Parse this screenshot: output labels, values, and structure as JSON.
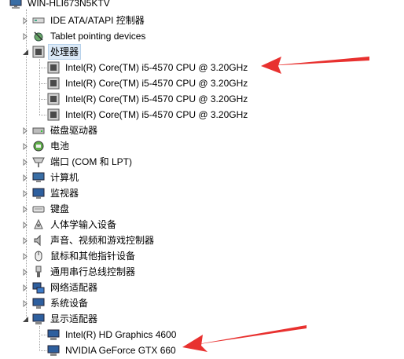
{
  "computer": {
    "name": "WIN-HLI673N5KTV"
  },
  "tree": [
    {
      "id": "ide",
      "label": "IDE ATA/ATAPI 控制器",
      "icon": "ide-controller-icon",
      "expanded": false
    },
    {
      "id": "tablet",
      "label": "Tablet pointing devices",
      "icon": "tablet-icon",
      "expanded": false
    },
    {
      "id": "processors",
      "label": "处理器",
      "icon": "processor-icon",
      "expanded": true,
      "children": [
        {
          "label": "Intel(R) Core(TM) i5-4570 CPU @ 3.20GHz",
          "icon": "processor-icon"
        },
        {
          "label": "Intel(R) Core(TM) i5-4570 CPU @ 3.20GHz",
          "icon": "processor-icon"
        },
        {
          "label": "Intel(R) Core(TM) i5-4570 CPU @ 3.20GHz",
          "icon": "processor-icon"
        },
        {
          "label": "Intel(R) Core(TM) i5-4570 CPU @ 3.20GHz",
          "icon": "processor-icon"
        }
      ]
    },
    {
      "id": "disk",
      "label": "磁盘驱动器",
      "icon": "disk-drive-icon",
      "expanded": false
    },
    {
      "id": "battery",
      "label": "电池",
      "icon": "battery-icon",
      "expanded": false
    },
    {
      "id": "ports",
      "label": "端口 (COM 和 LPT)",
      "icon": "port-icon",
      "expanded": false
    },
    {
      "id": "computer",
      "label": "计算机",
      "icon": "computer-icon",
      "expanded": false
    },
    {
      "id": "monitors",
      "label": "监视器",
      "icon": "monitor-icon",
      "expanded": false
    },
    {
      "id": "keyboard",
      "label": "键盘",
      "icon": "keyboard-icon",
      "expanded": false
    },
    {
      "id": "hid",
      "label": "人体学输入设备",
      "icon": "hid-icon",
      "expanded": false
    },
    {
      "id": "sound",
      "label": "声音、视频和游戏控制器",
      "icon": "speaker-icon",
      "expanded": false
    },
    {
      "id": "mouse",
      "label": "鼠标和其他指针设备",
      "icon": "mouse-icon",
      "expanded": false
    },
    {
      "id": "usb",
      "label": "通用串行总线控制器",
      "icon": "usb-icon",
      "expanded": false
    },
    {
      "id": "network",
      "label": "网络适配器",
      "icon": "network-adapter-icon",
      "expanded": false
    },
    {
      "id": "system",
      "label": "系统设备",
      "icon": "system-device-icon",
      "expanded": false
    },
    {
      "id": "display",
      "label": "显示适配器",
      "icon": "display-adapter-icon",
      "expanded": true,
      "children": [
        {
          "label": "Intel(R) HD Graphics 4600",
          "icon": "display-adapter-icon"
        },
        {
          "label": "NVIDIA GeForce GTX 660",
          "icon": "display-adapter-icon"
        }
      ]
    }
  ],
  "colors": {
    "arrow": "#e8312f",
    "selection": "#dbe9f7"
  }
}
